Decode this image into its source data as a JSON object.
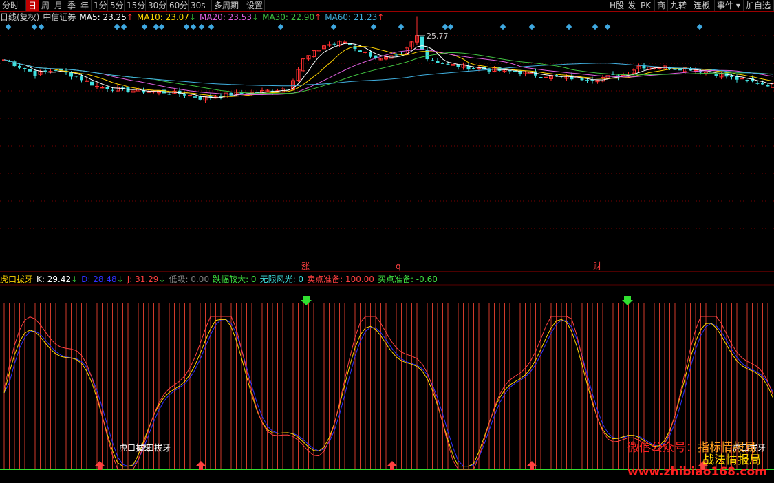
{
  "toolbar": {
    "left": [
      "分时",
      "日",
      "周",
      "月",
      "季",
      "年",
      "1分",
      "5分",
      "15分",
      "30分",
      "60分",
      "30s",
      "多周期",
      "设置"
    ],
    "active": "日",
    "right": [
      "H股",
      "发",
      "PK",
      "商",
      "九转",
      "连板",
      "事件",
      "加自选"
    ]
  },
  "legend": {
    "period": "日线(复权)",
    "stock": "中信证券",
    "ma": [
      {
        "label": "MA5:",
        "value": "23.25",
        "arrow": "↑",
        "color": "#ffffff"
      },
      {
        "label": "MA10:",
        "value": "23.07",
        "arrow": "↓",
        "color": "#ffd400"
      },
      {
        "label": "MA20:",
        "value": "23.53",
        "arrow": "↓",
        "color": "#e060e0"
      },
      {
        "label": "MA30:",
        "value": "22.90",
        "arrow": "↑",
        "color": "#40c040"
      },
      {
        "label": "MA60:",
        "value": "21.23",
        "arrow": "↑",
        "color": "#40b0e0"
      }
    ]
  },
  "price_chart": {
    "high_label": "25.77",
    "markers": [
      "涨",
      "q",
      "财"
    ],
    "colors": {
      "up": "#ff3030",
      "down": "#40e0e0",
      "ma5": "#ffffff",
      "ma10": "#ffd400",
      "ma20": "#e060e0",
      "ma30": "#40c040",
      "ma60": "#40b0e0",
      "grid": "#7a0000",
      "diamond": "#3fa8e0"
    }
  },
  "indicator_legend": {
    "name": "虎口拔牙",
    "items": [
      {
        "label": "K:",
        "value": "29.42",
        "arrow": "↓",
        "color": "#ffffff"
      },
      {
        "label": "D:",
        "value": "28.48",
        "arrow": "↓",
        "color": "#3030ff"
      },
      {
        "label": "J:",
        "value": "31.29",
        "arrow": "↓",
        "color": "#ff4040"
      },
      {
        "label": "低吸:",
        "value": "0.00",
        "arrow": "",
        "color": "#808080"
      },
      {
        "label": "跌幅较大:",
        "value": "0",
        "arrow": "",
        "color": "#40e040"
      },
      {
        "label": "无限风光:",
        "value": "0",
        "arrow": "",
        "color": "#40e0e0"
      },
      {
        "label": "卖点准备:",
        "value": "100.00",
        "arrow": "",
        "color": "#ff4040"
      },
      {
        "label": "买点准备:",
        "value": "-0.60",
        "arrow": "",
        "color": "#40e040"
      }
    ]
  },
  "indicator_chart": {
    "labels": [
      "虎口拔牙",
      "虎口拔牙",
      "虎口拔牙"
    ]
  },
  "watermark": {
    "line1a": "微信公众号：",
    "line1b": "指标情报局",
    "line2": "战法情报局",
    "url": "www.zhibiao168.com"
  }
}
